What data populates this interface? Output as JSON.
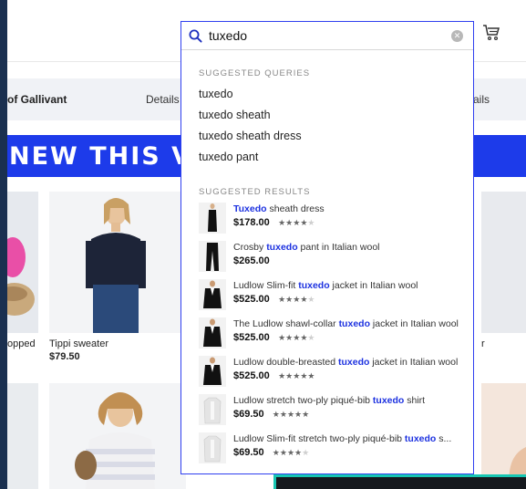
{
  "header": {
    "cart_icon": "cart-icon"
  },
  "subnav": {
    "brand": "of Gallivant",
    "details_left": "Details",
    "details_right": "ails"
  },
  "banner": {
    "text": "NEW THIS V"
  },
  "products": {
    "captions": [
      {
        "name": "opped"
      },
      {
        "name": "Tippi sweater",
        "price": "$79.50"
      },
      {
        "name": "r"
      }
    ]
  },
  "search": {
    "query": "tuxedo",
    "suggested_queries_title": "SUGGESTED QUERIES",
    "queries": [
      "tuxedo",
      "tuxedo sheath",
      "tuxedo sheath dress",
      "tuxedo pant"
    ],
    "suggested_results_title": "SUGGESTED RESULTS",
    "results": [
      {
        "pre": "",
        "highlight": "Tuxedo",
        "post": " sheath dress",
        "price": "$178.00",
        "stars": 4,
        "thumb": "dress"
      },
      {
        "pre": "Crosby ",
        "highlight": "tuxedo",
        "post": " pant in Italian wool",
        "price": "$265.00",
        "stars": 0,
        "thumb": "pant"
      },
      {
        "pre": "Ludlow Slim-fit ",
        "highlight": "tuxedo",
        "post": " jacket in Italian wool",
        "price": "$525.00",
        "stars": 4,
        "thumb": "jacket"
      },
      {
        "pre": "The Ludlow shawl-collar ",
        "highlight": "tuxedo",
        "post": " jacket in Italian wool",
        "price": "$525.00",
        "stars": 4,
        "thumb": "jacket"
      },
      {
        "pre": "Ludlow double-breasted ",
        "highlight": "tuxedo",
        "post": " jacket in Italian wool",
        "price": "$525.00",
        "stars": 5,
        "thumb": "jacket"
      },
      {
        "pre": "Ludlow stretch two-ply piqué-bib ",
        "highlight": "tuxedo",
        "post": " shirt",
        "price": "$69.50",
        "stars": 5,
        "thumb": "shirt"
      },
      {
        "pre": "Ludlow Slim-fit stretch two-ply piqué-bib ",
        "highlight": "tuxedo",
        "post": " s...",
        "price": "$69.50",
        "stars": 4,
        "thumb": "shirt"
      }
    ]
  },
  "colors": {
    "accent": "#1d3bea",
    "highlight": "#1d32e0",
    "frame": "#1a3050",
    "teal": "#17c6b2"
  }
}
